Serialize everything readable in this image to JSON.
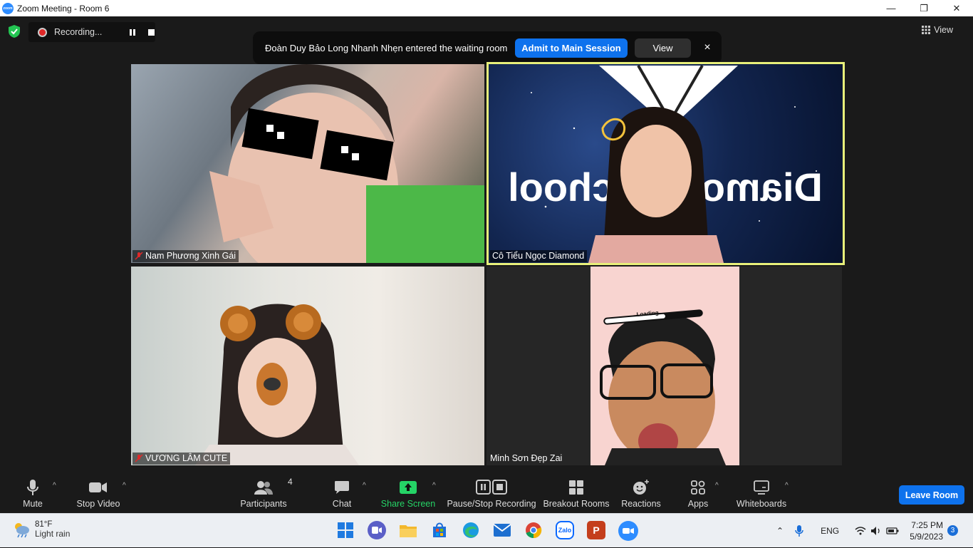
{
  "window": {
    "title": "Zoom Meeting - Room 6",
    "minimize": "—",
    "maximize": "❐",
    "close": "✕",
    "logo_text": "zoom"
  },
  "recording": {
    "label": "Recording..."
  },
  "notification": {
    "message": "Đoàn Duy Bảo Long Nhanh Nhẹn entered the waiting room",
    "admit_label": "Admit to Main Session",
    "view_label": "View",
    "close_glyph": "×"
  },
  "view_button": {
    "label": "View"
  },
  "participants": [
    {
      "name": "Nam Phương Xinh Gái",
      "muted": true
    },
    {
      "name": "Cô Tiểu Ngọc Diamond",
      "muted": false,
      "active_speaker": true
    },
    {
      "name": "VƯƠNG LÂM CUTE",
      "muted": true
    },
    {
      "name": "Minh Sơn Đẹp Zai",
      "muted": false
    }
  ],
  "tile_overlays": {
    "background_text": "Diamond School",
    "loading_text": "Loading..."
  },
  "toolbar": {
    "mute": "Mute",
    "stop_video": "Stop Video",
    "participants": "Participants",
    "participants_count": "4",
    "chat": "Chat",
    "share_screen": "Share Screen",
    "pause_stop_recording": "Pause/Stop Recording",
    "breakout_rooms": "Breakout Rooms",
    "reactions": "Reactions",
    "apps": "Apps",
    "whiteboards": "Whiteboards",
    "leave_room": "Leave Room",
    "caret": "^"
  },
  "taskbar": {
    "weather_temp": "81°F",
    "weather_cond": "Light rain",
    "language": "ENG",
    "time": "7:25 PM",
    "date": "5/9/2023",
    "notification_count": "3",
    "apps": [
      "start-icon",
      "teams-icon",
      "file-explorer-icon",
      "microsoft-store-icon",
      "edge-icon",
      "mail-icon",
      "chrome-icon",
      "zalo-icon",
      "powerpoint-icon",
      "zoom-icon"
    ],
    "zalo_label": "Zalo",
    "powerpoint_letter": "P"
  },
  "colors": {
    "accent": "#0e72ed",
    "share_green": "#25d366",
    "active_border": "#e8f07a"
  }
}
